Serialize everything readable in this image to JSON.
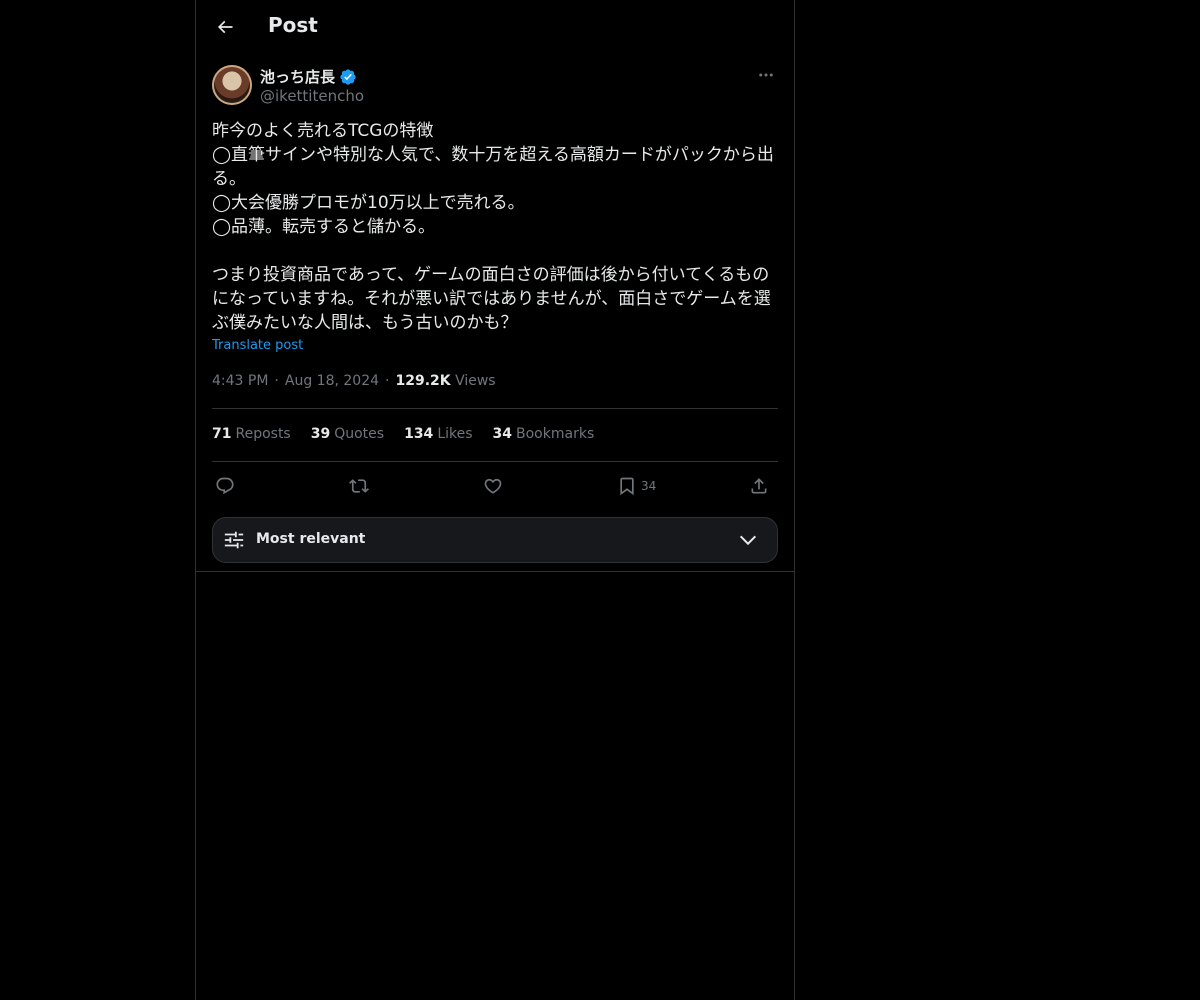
{
  "header": {
    "title": "Post"
  },
  "author": {
    "name": "池っち店長",
    "handle": "@ikettitencho"
  },
  "post": {
    "text": "昨今のよく売れるTCGの特徴\n◯直筆サインや特別な人気で、数十万を超える高額カードがパックから出る。\n◯大会優勝プロモが10万以上で売れる。\n◯品薄。転売すると儲かる。\n\nつまり投資商品であって、ゲームの面白さの評価は後から付いてくるものになっていますね。それが悪い訳ではありませんが、面白さでゲームを選ぶ僕みたいな人間は、もう古いのかも？",
    "translate_label": "Translate post",
    "time": "4:43 PM",
    "date": "Aug 18, 2024",
    "views_count": "129.2K",
    "views_label": "Views",
    "sep": "·"
  },
  "stats": [
    {
      "count": "71",
      "label": "Reposts"
    },
    {
      "count": "39",
      "label": "Quotes"
    },
    {
      "count": "134",
      "label": "Likes"
    },
    {
      "count": "34",
      "label": "Bookmarks"
    }
  ],
  "actions": {
    "reply_icon": "reply-icon",
    "repost_icon": "repost-icon",
    "like_icon": "heart-icon",
    "bookmark_icon": "bookmark-icon",
    "bookmark_count": "34",
    "share_icon": "share-icon"
  },
  "sort": {
    "label": "Most relevant"
  },
  "colors": {
    "background": "#000000",
    "text": "#e7e9ea",
    "muted": "#71767b",
    "accent": "#1d9bf0",
    "border": "#2f3336"
  }
}
